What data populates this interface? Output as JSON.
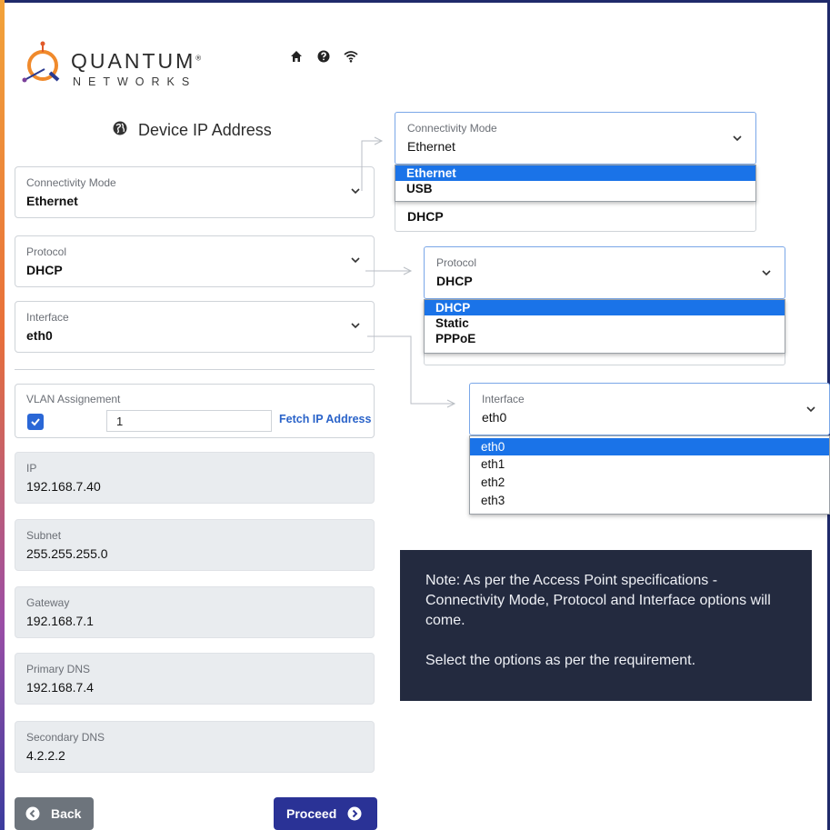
{
  "brand": {
    "name": "QUANTUM",
    "sub": "NETWORKS",
    "reg": "®"
  },
  "header": {
    "icons": [
      "home-icon",
      "help-icon",
      "wifi-icon"
    ]
  },
  "page": {
    "title": "Device IP Address",
    "title_icon": "globe-icon"
  },
  "form": {
    "connectivity": {
      "label": "Connectivity Mode",
      "value": "Ethernet"
    },
    "protocol": {
      "label": "Protocol",
      "value": "DHCP"
    },
    "interface": {
      "label": "Interface",
      "value": "eth0"
    },
    "vlan": {
      "label": "VLAN Assignement",
      "checked": true,
      "value": "1",
      "fetch_label": "Fetch IP Address"
    },
    "ip": {
      "label": "IP",
      "value": "192.168.7.40"
    },
    "subnet": {
      "label": "Subnet",
      "value": "255.255.255.0"
    },
    "gateway": {
      "label": "Gateway",
      "value": "192.168.7.1"
    },
    "primary_dns": {
      "label": "Primary DNS",
      "value": "192.168.7.4"
    },
    "secondary_dns": {
      "label": "Secondary DNS",
      "value": "4.2.2.2"
    }
  },
  "buttons": {
    "back": "Back",
    "proceed": "Proceed"
  },
  "callouts": {
    "connectivity": {
      "label": "Connectivity Mode",
      "value": "Ethernet",
      "under_value": "DHCP",
      "options": [
        "Ethernet",
        "USB"
      ],
      "selected": "Ethernet"
    },
    "protocol": {
      "label": "Protocol",
      "value": "DHCP",
      "options": [
        "DHCP",
        "Static",
        "PPPoE"
      ],
      "selected": "DHCP"
    },
    "interface": {
      "label": "Interface",
      "value": "eth0",
      "options": [
        "eth0",
        "eth1",
        "eth2",
        "eth3"
      ],
      "selected": "eth0"
    }
  },
  "note": {
    "line1": "Note: As per the Access Point specifications -Connectivity Mode, Protocol and Interface options will come.",
    "line2": "Select the options as per the requirement."
  },
  "colors": {
    "accent": "#1a73e8",
    "proceed": "#2a3296",
    "back": "#6d747c",
    "note_bg": "#232a3f",
    "link": "#2a63c9"
  }
}
